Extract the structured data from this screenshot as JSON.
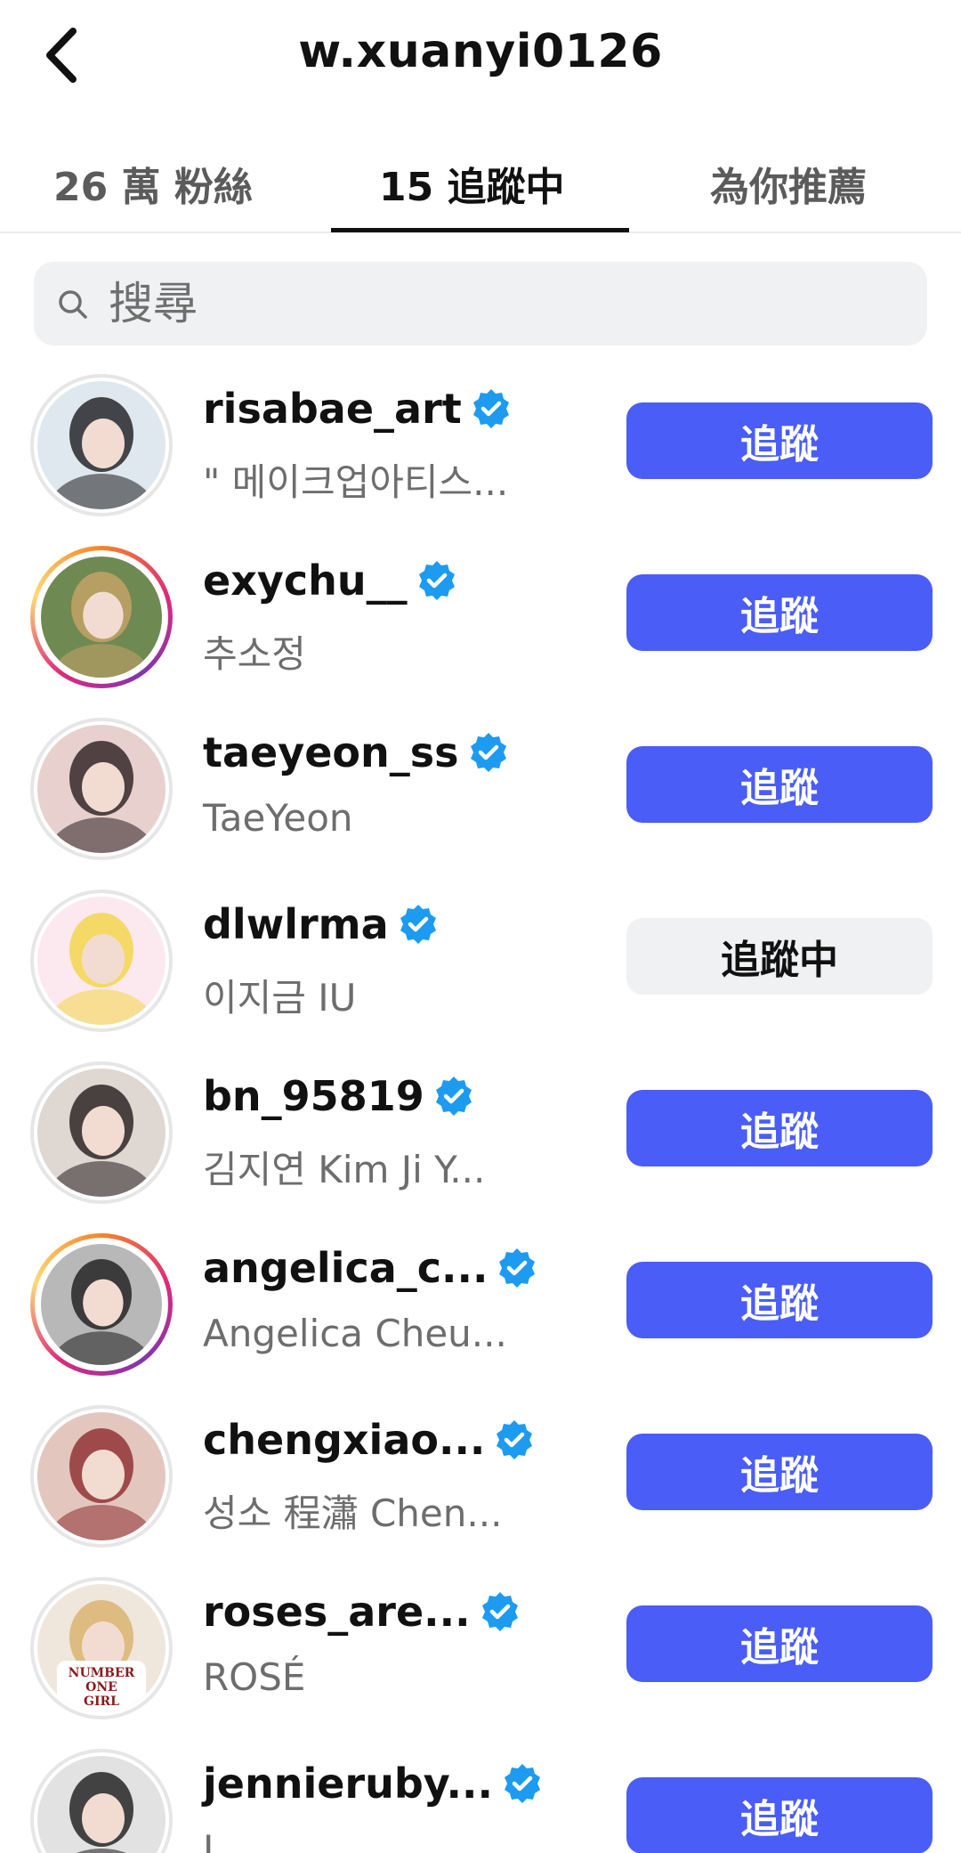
{
  "header": {
    "title": "w.xuanyi0126"
  },
  "tabs": [
    {
      "label": "26 萬 粉絲",
      "active": false
    },
    {
      "label": "15 追蹤中",
      "active": true
    },
    {
      "label": "為你推薦",
      "active": false
    }
  ],
  "search": {
    "placeholder": "搜尋"
  },
  "accounts": [
    {
      "username": "risabae_art",
      "fullname": "\" 메이크업아티스...",
      "button": "追蹤",
      "following": false,
      "story_ring": false,
      "avatar_colors": [
        "#dfe8ee",
        "#1a1a1f"
      ]
    },
    {
      "username": "exychu__",
      "fullname": "추소정",
      "button": "追蹤",
      "following": false,
      "story_ring": true,
      "avatar_colors": [
        "#6e8a52",
        "#c9a368"
      ]
    },
    {
      "username": "taeyeon_ss",
      "fullname": "TaeYeon",
      "button": "追蹤",
      "following": false,
      "story_ring": false,
      "avatar_colors": [
        "#e7d0ce",
        "#2b1d1f"
      ]
    },
    {
      "username": "dlwlrma",
      "fullname": "이지금 IU",
      "button": "追蹤中",
      "following": true,
      "story_ring": false,
      "avatar_colors": [
        "#fbe9ef",
        "#f4d545"
      ]
    },
    {
      "username": "bn_95819",
      "fullname": "김지연 Kim Ji Y...",
      "button": "追蹤",
      "following": false,
      "story_ring": false,
      "avatar_colors": [
        "#ded7d2",
        "#231c1c"
      ]
    },
    {
      "username": "angelica_c...",
      "fullname": "Angelica Cheu...",
      "button": "追蹤",
      "following": false,
      "story_ring": true,
      "avatar_colors": [
        "#b8b8b8",
        "#1c1c1c"
      ]
    },
    {
      "username": "chengxiao...",
      "fullname": "성소 程瀟 Chen...",
      "button": "追蹤",
      "following": false,
      "story_ring": false,
      "avatar_colors": [
        "#e3c7bf",
        "#8c2a2e"
      ]
    },
    {
      "username": "roses_are...",
      "fullname": "ROSÉ",
      "button": "追蹤",
      "following": false,
      "story_ring": false,
      "avatar_colors": [
        "#efe6dc",
        "#d9b06a"
      ],
      "shirt_text": [
        "NUMBER",
        "ONE",
        "GIRL"
      ]
    },
    {
      "username": "jennieruby...",
      "fullname": "J",
      "button": "追蹤",
      "following": false,
      "story_ring": false,
      "avatar_colors": [
        "#e2e2e2",
        "#1a1a1a"
      ]
    }
  ],
  "colors": {
    "accent": "#4a5df6",
    "verified": "#1d9bf0",
    "secondary_text": "#6d6d6d",
    "search_bg": "#eff1f3"
  },
  "icons": {
    "back": "chevron-left-icon",
    "search": "search-icon",
    "verified": "verified-badge-icon"
  }
}
